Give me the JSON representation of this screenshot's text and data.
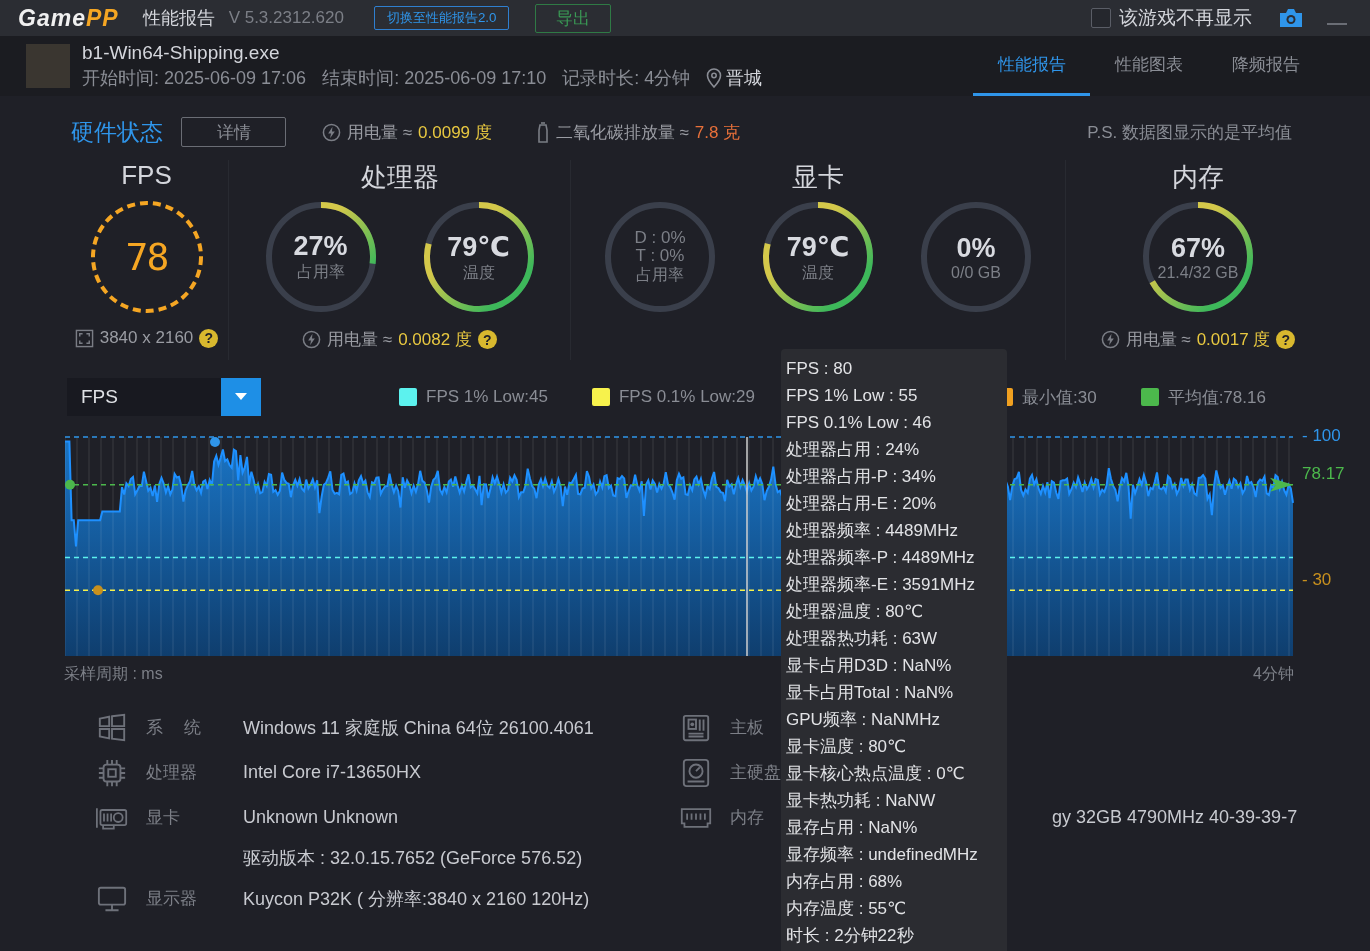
{
  "titlebar": {
    "logo": {
      "main": "Game",
      "accent": "PP"
    },
    "title": "性能报告",
    "version": "V 5.3.2312.620",
    "switch_button": "切换至性能报告2.0",
    "export_button": "导出",
    "dont_show": {
      "label": "该游戏不再显示",
      "checked": false
    }
  },
  "session": {
    "exe": "b1-Win64-Shipping.exe",
    "start": "开始时间: 2025-06-09 17:06",
    "end": "结束时间: 2025-06-09 17:10",
    "duration": "记录时长: 4分钟",
    "location": "晋城"
  },
  "tabs": [
    {
      "label": "性能报告",
      "selected": true
    },
    {
      "label": "性能图表",
      "selected": false
    },
    {
      "label": "降频报告",
      "selected": false
    }
  ],
  "hardware_status": {
    "title": "硬件状态",
    "details_button": "详情",
    "power": {
      "label": "用电量 ≈",
      "value": "0.0099 度"
    },
    "co2": {
      "label": "二氧化碳排放量 ≈",
      "value": "7.8 克"
    },
    "note": "P.S. 数据图显示的是平均值"
  },
  "panels": [
    {
      "title": "FPS",
      "gauges": [
        {
          "kind": "fps",
          "value": "78"
        }
      ],
      "footer": {
        "kind": "resolution",
        "text": "3840 x 2160",
        "help": "?"
      }
    },
    {
      "title": "处理器",
      "gauges": [
        {
          "kind": "arc",
          "value": "27%",
          "label": "占用率",
          "level": 0.27
        },
        {
          "kind": "arc",
          "value": "79℃",
          "label": "温度",
          "level": 0.79
        }
      ],
      "footer": {
        "kind": "power",
        "label": "用电量 ≈",
        "value": "0.0082 度",
        "help": "?"
      }
    },
    {
      "title": "显卡",
      "gauges": [
        {
          "kind": "split",
          "lines": [
            "D : 0%",
            "T : 0%"
          ],
          "label": "占用率"
        },
        {
          "kind": "arc",
          "value": "79℃",
          "label": "温度",
          "level": 0.79
        },
        {
          "kind": "arc",
          "value": "0%",
          "label": "0/0 GB"
        }
      ]
    },
    {
      "title": "内存",
      "gauges": [
        {
          "kind": "arc",
          "value": "67%",
          "label": "21.4/32 GB",
          "level": 0.67
        }
      ],
      "footer": {
        "kind": "power",
        "label": "用电量 ≈",
        "value": "0.0017 度",
        "help": "?"
      }
    }
  ],
  "chart": {
    "metric_select": "FPS",
    "legend": [
      {
        "label": "FPS 1% Low:45",
        "color": "#5cf2ee"
      },
      {
        "label": "FPS 0.1% Low:29",
        "color": "#f7f24c"
      },
      {
        "label": "最小值:30",
        "color": "#f0a020"
      },
      {
        "label": "平均值:78.16",
        "color": "#4cb84c"
      }
    ],
    "ref_labels": [
      {
        "kind": "max",
        "text": "- 100"
      },
      {
        "kind": "avg",
        "text": "78.17"
      },
      {
        "kind": "min",
        "text": "- 30"
      }
    ],
    "x_start": "采样周期 : ms",
    "x_end": "4分钟"
  },
  "system_info": {
    "left": [
      {
        "kind": "windows",
        "label": "系 统",
        "value": "Windows 11 家庭版 China 64位 26100.4061"
      },
      {
        "kind": "cpu",
        "label": "处理器",
        "value": "Intel Core i7-13650HX"
      },
      {
        "kind": "gpu",
        "label": "显卡",
        "value": "Unknown Unknown",
        "extra": "驱动版本 : 32.0.15.7652 (GeForce 576.52)"
      },
      {
        "kind": "monitor",
        "label": "显示器",
        "value": "Kuycon P32K ( 分辨率:3840 x 2160 120Hz)"
      }
    ],
    "right": [
      {
        "kind": "board",
        "label": "主板"
      },
      {
        "kind": "disk",
        "label": "主硬盘"
      },
      {
        "kind": "memory",
        "label": "内存",
        "value": "gy 32GB 4790MHz 40-39-39-7"
      }
    ]
  },
  "tooltip": [
    "FPS : 80",
    "FPS 1% Low : 55",
    "FPS 0.1% Low : 46",
    "处理器占用 : 24%",
    "处理器占用-P : 34%",
    "处理器占用-E : 20%",
    "处理器频率 : 4489MHz",
    "处理器频率-P : 4489MHz",
    "处理器频率-E : 3591MHz",
    "处理器温度 : 80℃",
    "处理器热功耗 : 63W",
    "显卡占用D3D : NaN%",
    "显卡占用Total : NaN%",
    "GPU频率 : NaNMHz",
    "显卡温度 : 80℃",
    "显卡核心热点温度 : 0℃",
    "显卡热功耗 : NaNW",
    "显存占用 : NaN%",
    "显存频率 : undefinedMHz",
    "内存占用 : 68%",
    "内存温度 : 55℃",
    "时长 : 2分钟22秒"
  ]
}
